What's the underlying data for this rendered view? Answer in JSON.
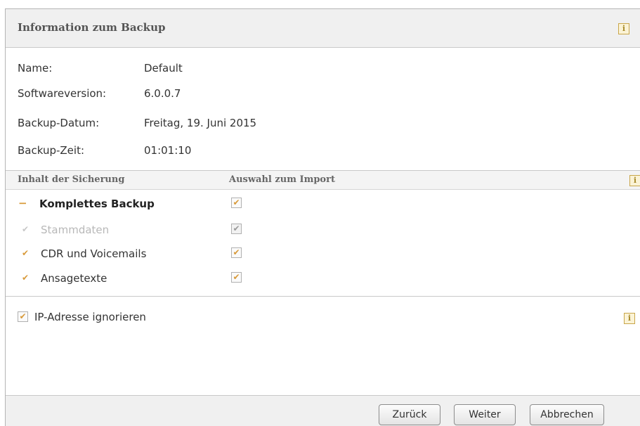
{
  "header": {
    "title": "Information zum Backup"
  },
  "info": [
    {
      "label": "Name:",
      "value": "Default"
    },
    {
      "label": "Softwareversion:",
      "value": "6.0.0.7"
    },
    {
      "label": "Backup-Datum:",
      "value": "Freitag, 19. Juni 2015"
    },
    {
      "label": "Backup-Zeit:",
      "value": "01:01:10"
    }
  ],
  "columns": {
    "content": "Inhalt der Sicherung",
    "selection": "Auswahl zum Import"
  },
  "tree": {
    "root": {
      "collapse_symbol": "−",
      "label": "Komplettes Backup",
      "checked": true
    },
    "children": [
      {
        "mark": "✔",
        "label": "Stammdaten",
        "disabled": true,
        "checked": true
      },
      {
        "mark": "✔",
        "label": "CDR und Voicemails",
        "disabled": false,
        "checked": true
      },
      {
        "mark": "✔",
        "label": "Ansagetexte",
        "disabled": false,
        "checked": true
      }
    ]
  },
  "options": {
    "ignore_ip_label": "IP-Adresse ignorieren",
    "ignore_ip_checked": true
  },
  "icons": {
    "info": "i",
    "check": "✔"
  },
  "colors": {
    "check_accent": "#d89a3a",
    "disabled_text": "#b8b8b8",
    "header_bg": "#f0f0f0"
  },
  "buttons": {
    "back": "Zurück",
    "next": "Weiter",
    "cancel": "Abbrechen"
  }
}
